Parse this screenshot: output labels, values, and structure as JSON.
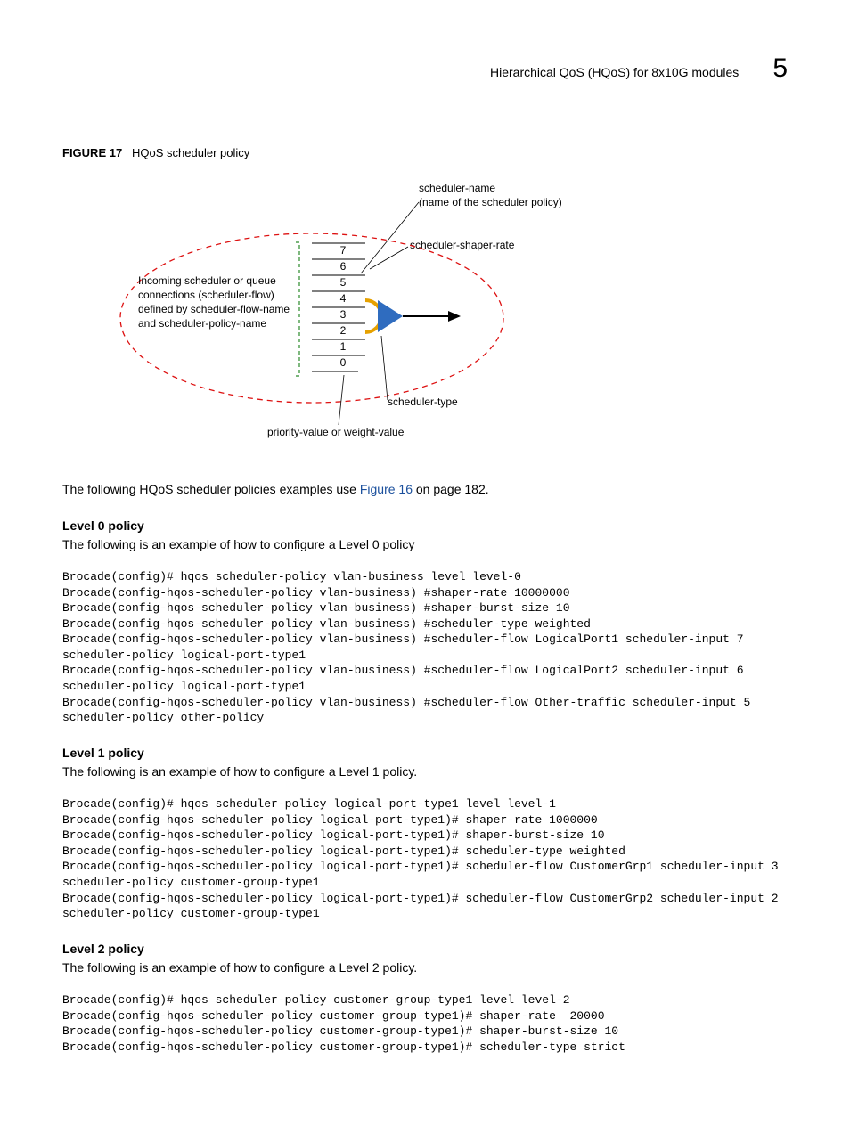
{
  "header": {
    "title": "Hierarchical QoS (HQoS) for 8x10G modules",
    "chapter": "5"
  },
  "figure": {
    "label": "FIGURE 17",
    "caption": "HQoS scheduler policy",
    "labels": {
      "scheduler_name_l1": "scheduler-name",
      "scheduler_name_l2": "(name of the scheduler policy)",
      "shaper_rate": "scheduler-shaper-rate",
      "incoming_l1": "Incoming scheduler or queue",
      "incoming_l2": "connections (scheduler-flow)",
      "incoming_l3": "defined by scheduler-flow-name",
      "incoming_l4": "and scheduler-policy-name",
      "scheduler_type": "scheduler-type",
      "priority_weight": "priority-value or weight-value",
      "n7": "7",
      "n6": "6",
      "n5": "5",
      "n4": "4",
      "n3": "3",
      "n2": "2",
      "n1": "1",
      "n0": "0"
    }
  },
  "intro": {
    "prefix": "The following HQoS scheduler policies examples use ",
    "link": "Figure 16",
    "suffix": " on page 182."
  },
  "sections": {
    "level0": {
      "heading": "Level 0 policy",
      "intro": "The following is an example of how to configure a Level 0 policy",
      "code": "Brocade(config)# hqos scheduler-policy vlan-business level level-0\nBrocade(config-hqos-scheduler-policy vlan-business) #shaper-rate 10000000\nBrocade(config-hqos-scheduler-policy vlan-business) #shaper-burst-size 10\nBrocade(config-hqos-scheduler-policy vlan-business) #scheduler-type weighted\nBrocade(config-hqos-scheduler-policy vlan-business) #scheduler-flow LogicalPort1 scheduler-input 7 scheduler-policy logical-port-type1\nBrocade(config-hqos-scheduler-policy vlan-business) #scheduler-flow LogicalPort2 scheduler-input 6 scheduler-policy logical-port-type1\nBrocade(config-hqos-scheduler-policy vlan-business) #scheduler-flow Other-traffic scheduler-input 5 scheduler-policy other-policy"
    },
    "level1": {
      "heading": "Level 1 policy",
      "intro": "The following is an example of how to configure a Level 1 policy.",
      "code": "Brocade(config)# hqos scheduler-policy logical-port-type1 level level-1\nBrocade(config-hqos-scheduler-policy logical-port-type1)# shaper-rate 1000000\nBrocade(config-hqos-scheduler-policy logical-port-type1)# shaper-burst-size 10\nBrocade(config-hqos-scheduler-policy logical-port-type1)# scheduler-type weighted\nBrocade(config-hqos-scheduler-policy logical-port-type1)# scheduler-flow CustomerGrp1 scheduler-input 3 scheduler-policy customer-group-type1\nBrocade(config-hqos-scheduler-policy logical-port-type1)# scheduler-flow CustomerGrp2 scheduler-input 2 scheduler-policy customer-group-type1"
    },
    "level2": {
      "heading": "Level 2 policy",
      "intro": "The following is an example of how to configure a Level 2 policy.",
      "code": "Brocade(config)# hqos scheduler-policy customer-group-type1 level level-2\nBrocade(config-hqos-scheduler-policy customer-group-type1)# shaper-rate  20000\nBrocade(config-hqos-scheduler-policy customer-group-type1)# shaper-burst-size 10\nBrocade(config-hqos-scheduler-policy customer-group-type1)# scheduler-type strict"
    }
  }
}
